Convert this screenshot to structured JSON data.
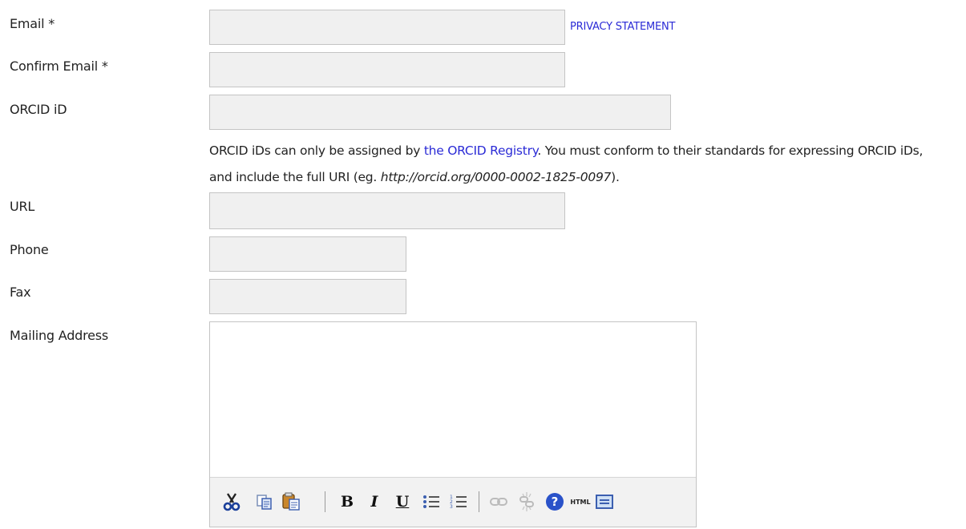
{
  "fields": {
    "email": {
      "label": "Email *",
      "value": ""
    },
    "confirm_email": {
      "label": "Confirm Email *",
      "value": ""
    },
    "orcid": {
      "label": "ORCID iD",
      "value": ""
    },
    "url": {
      "label": "URL",
      "value": ""
    },
    "phone": {
      "label": "Phone",
      "value": ""
    },
    "fax": {
      "label": "Fax",
      "value": ""
    },
    "mailing_address": {
      "label": "Mailing Address",
      "value": ""
    }
  },
  "privacy_link": "PRIVACY STATEMENT",
  "orcid_help": {
    "text_before": "ORCID iDs can only be assigned by ",
    "link": "the ORCID Registry",
    "text_after": ". You must conform to their standards for expressing ORCID iDs, and include the full URI (eg. ",
    "example": "http://orcid.org/0000-0002-1825-0097",
    "text_end": ")."
  },
  "toolbar": {
    "html_label": "HTML",
    "bold": "B",
    "italic": "I",
    "underline": "U",
    "help": "?"
  },
  "icons": [
    "cut-icon",
    "copy-icon",
    "paste-icon",
    "bold-icon",
    "italic-icon",
    "underline-icon",
    "bullet-list-icon",
    "numbered-list-icon",
    "link-icon",
    "unlink-icon",
    "help-icon",
    "html-icon",
    "code-icon"
  ],
  "colors": {
    "link": "#2b2bd6",
    "field_bg": "#f0f0f0",
    "field_border": "#c4c4c4"
  }
}
